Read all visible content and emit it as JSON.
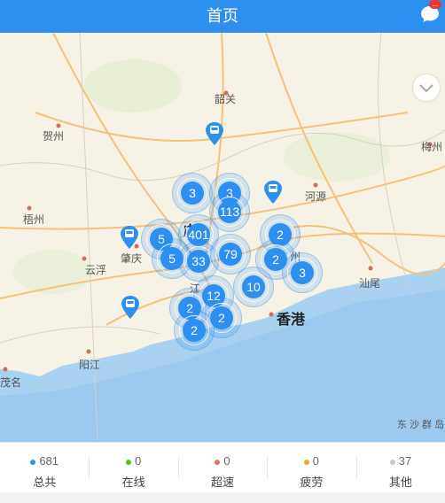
{
  "header": {
    "title": "首页",
    "chat_icon": "chat-bubble-icon",
    "badge": "..."
  },
  "map": {
    "places": {
      "shaoguan": "韶关",
      "hezhou": "贺州",
      "heyuan": "河源",
      "meizhou": "梅州",
      "wuzhou": "梧州",
      "zhaoqing": "肇庆",
      "yunfu": "云浮",
      "shanwei": "汕尾",
      "yangjiang": "阳江",
      "maoming": "茂名",
      "hongkong": "香港",
      "dongsha": "东沙群岛",
      "guangzhou": "广",
      "jiang": "江",
      "zhou": "州"
    },
    "clusters": [
      "3",
      "3",
      "113",
      "401",
      "5",
      "5",
      "33",
      "79",
      "2",
      "2",
      "3",
      "10",
      "12",
      "2",
      "2",
      "2"
    ],
    "vehicle_icon": "bus-marker-icon"
  },
  "stats": [
    {
      "count": "681",
      "label": "总共",
      "color": "#2d8ff0"
    },
    {
      "count": "0",
      "label": "在线",
      "color": "#52c41a"
    },
    {
      "count": "0",
      "label": "超速",
      "color": "#f06a5e"
    },
    {
      "count": "0",
      "label": "疲劳",
      "color": "#f5a623"
    },
    {
      "count": "37",
      "label": "其他",
      "color": "#c8c8c8"
    }
  ]
}
